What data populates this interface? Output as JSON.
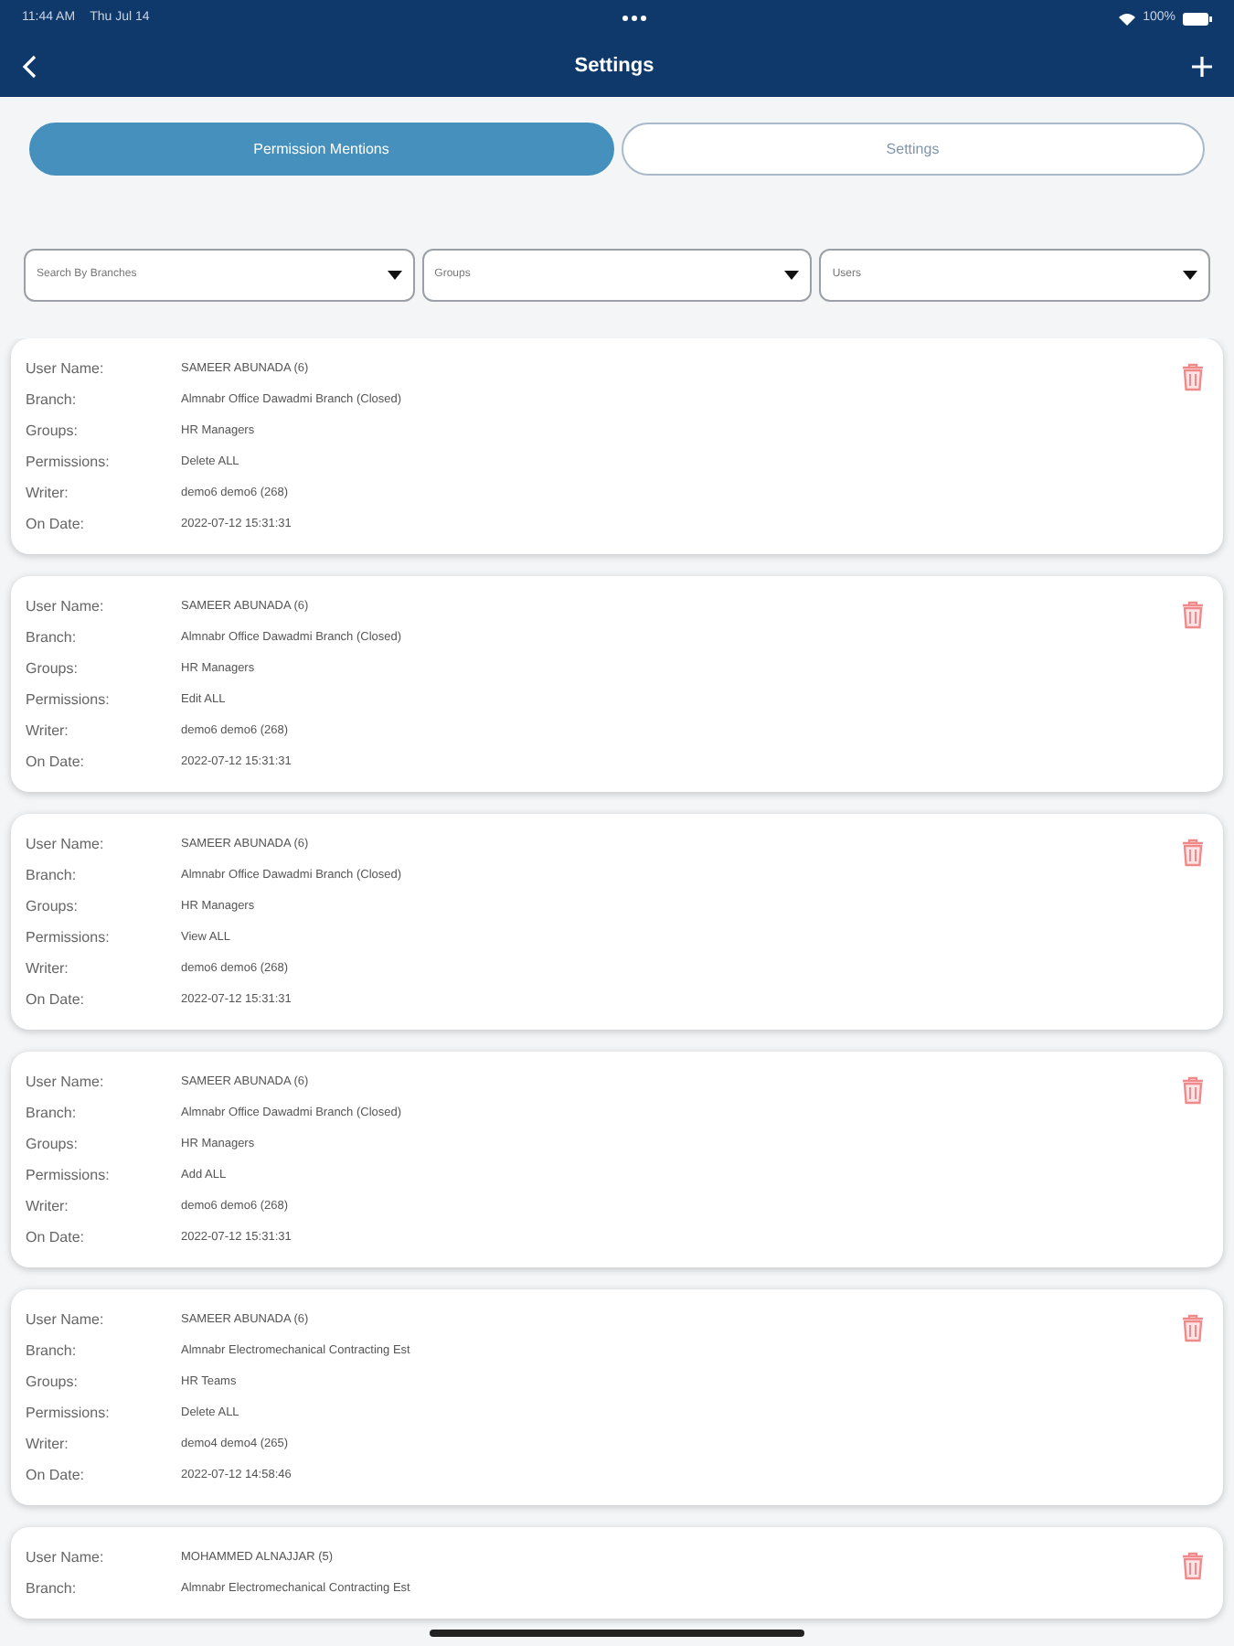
{
  "status_bar": {
    "time": "11:44 AM",
    "date": "Thu Jul 14",
    "battery": "100%"
  },
  "header": {
    "title": "Settings"
  },
  "tabs": [
    {
      "label": "Permission Mentions",
      "selected": true
    },
    {
      "label": "Settings",
      "selected": false
    }
  ],
  "filters": [
    {
      "placeholder": "Search By Branches"
    },
    {
      "placeholder": "Groups"
    },
    {
      "placeholder": "Users"
    }
  ],
  "records": [
    {
      "fields": [
        {
          "label": "User Name:",
          "value": "SAMEER ABUNADA (6)"
        },
        {
          "label": "Branch:",
          "value": "Almnabr Office Dawadmi Branch (Closed)"
        },
        {
          "label": "Groups:",
          "value": "HR Managers"
        },
        {
          "label": "Permissions:",
          "value": "Delete ALL"
        },
        {
          "label": "Writer:",
          "value": "demo6 demo6 (268)"
        },
        {
          "label": "On Date:",
          "value": "2022-07-12 15:31:31"
        }
      ]
    },
    {
      "fields": [
        {
          "label": "User Name:",
          "value": "SAMEER ABUNADA (6)"
        },
        {
          "label": "Branch:",
          "value": "Almnabr Office Dawadmi Branch (Closed)"
        },
        {
          "label": "Groups:",
          "value": "HR Managers"
        },
        {
          "label": "Permissions:",
          "value": "Edit ALL"
        },
        {
          "label": "Writer:",
          "value": "demo6 demo6 (268)"
        },
        {
          "label": "On Date:",
          "value": "2022-07-12 15:31:31"
        }
      ]
    },
    {
      "fields": [
        {
          "label": "User Name:",
          "value": "SAMEER ABUNADA (6)"
        },
        {
          "label": "Branch:",
          "value": "Almnabr Office Dawadmi Branch (Closed)"
        },
        {
          "label": "Groups:",
          "value": "HR Managers"
        },
        {
          "label": "Permissions:",
          "value": "View ALL"
        },
        {
          "label": "Writer:",
          "value": "demo6 demo6 (268)"
        },
        {
          "label": "On Date:",
          "value": "2022-07-12 15:31:31"
        }
      ]
    },
    {
      "fields": [
        {
          "label": "User Name:",
          "value": "SAMEER ABUNADA (6)"
        },
        {
          "label": "Branch:",
          "value": "Almnabr Office Dawadmi Branch (Closed)"
        },
        {
          "label": "Groups:",
          "value": "HR Managers"
        },
        {
          "label": "Permissions:",
          "value": "Add ALL"
        },
        {
          "label": "Writer:",
          "value": "demo6 demo6 (268)"
        },
        {
          "label": "On Date:",
          "value": "2022-07-12 15:31:31"
        }
      ]
    },
    {
      "fields": [
        {
          "label": "User Name:",
          "value": "SAMEER ABUNADA (6)"
        },
        {
          "label": "Branch:",
          "value": "Almnabr Electromechanical Contracting Est"
        },
        {
          "label": "Groups:",
          "value": "HR Teams"
        },
        {
          "label": "Permissions:",
          "value": "Delete ALL"
        },
        {
          "label": "Writer:",
          "value": "demo4 demo4 (265)"
        },
        {
          "label": "On Date:",
          "value": "2022-07-12 14:58:46"
        }
      ]
    },
    {
      "fields": [
        {
          "label": "User Name:",
          "value": "MOHAMMED ALNAJJAR (5)"
        },
        {
          "label": "Branch:",
          "value": "Almnabr Electromechanical Contracting Est"
        }
      ]
    }
  ]
}
